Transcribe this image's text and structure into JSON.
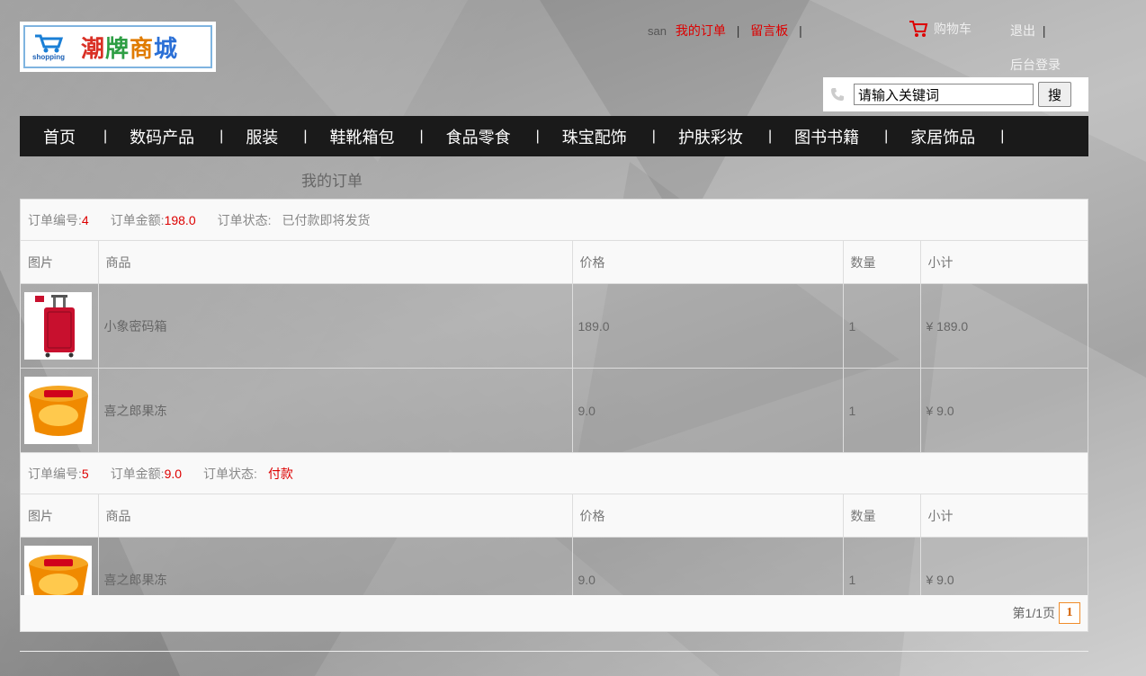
{
  "logo": {
    "cart_text": "shopping",
    "title_chars": [
      "潮",
      "牌",
      "商",
      "城"
    ]
  },
  "header": {
    "user": "san",
    "my_orders": "我的订单",
    "message_board": "留言板",
    "sep": "|",
    "cart": "购物车",
    "logout": "退出",
    "admin_login": "后台登录"
  },
  "search": {
    "placeholder": "请输入关键词",
    "value": "请输入关键词",
    "button": "搜"
  },
  "nav": {
    "items": [
      "首页",
      "数码产品",
      "服装",
      "鞋靴箱包",
      "食品零食",
      "珠宝配饰",
      "护肤彩妆",
      "图书书籍",
      "家居饰品"
    ],
    "sep": "|"
  },
  "page_title": "我的订单",
  "table_headers": {
    "image": "图片",
    "product": "商品",
    "price": "价格",
    "quantity": "数量",
    "subtotal": "小计"
  },
  "order_labels": {
    "id": "订单编号:",
    "amount": "订单金额:",
    "status": "订单状态:"
  },
  "orders": [
    {
      "id": "4",
      "amount": "198.0",
      "status": "已付款即将发货",
      "items": [
        {
          "name": "小象密码箱",
          "price": "189.0",
          "qty": "1",
          "subtotal": "¥ 189.0",
          "icon": "red-suitcase"
        },
        {
          "name": "喜之郎果冻",
          "price": "9.0",
          "qty": "1",
          "subtotal": "¥ 9.0",
          "icon": "jelly-cup"
        }
      ]
    },
    {
      "id": "5",
      "amount": "9.0",
      "status": "付款",
      "items": [
        {
          "name": "喜之郎果冻",
          "price": "9.0",
          "qty": "1",
          "subtotal": "¥ 9.0",
          "icon": "jelly-cup"
        }
      ]
    }
  ],
  "pagination": {
    "info": "第1/1页",
    "current": "1"
  },
  "colors": {
    "nav_bg": "#1a1a1a",
    "accent_red": "#dd0000",
    "page_num": "#f08c2a"
  }
}
